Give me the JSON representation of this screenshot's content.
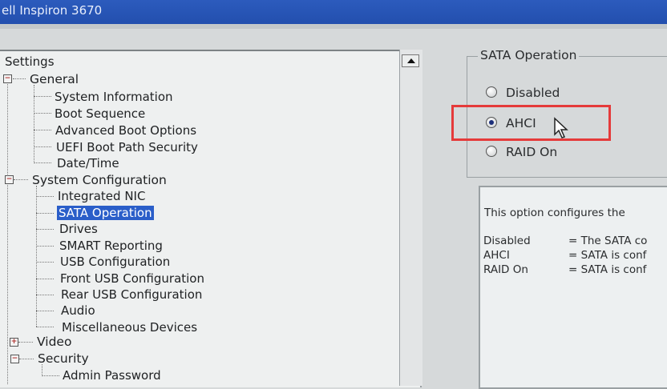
{
  "window": {
    "title": "ell Inspiron 3670"
  },
  "tree": {
    "header": "Settings",
    "general": {
      "label": "General",
      "items": [
        "System Information",
        "Boot Sequence",
        "Advanced Boot Options",
        "UEFI Boot Path Security",
        "Date/Time"
      ]
    },
    "system_configuration": {
      "label": "System Configuration",
      "items": [
        "Integrated NIC",
        "SATA Operation",
        "Drives",
        "SMART Reporting",
        "USB Configuration",
        "Front USB Configuration",
        "Rear USB Configuration",
        "Audio",
        "Miscellaneous Devices"
      ],
      "selected": "SATA Operation"
    },
    "video": {
      "label": "Video"
    },
    "security": {
      "label": "Security",
      "items": [
        "Admin Password"
      ]
    }
  },
  "sata_operation": {
    "title": "SATA Operation",
    "options": [
      "Disabled",
      "AHCI",
      "RAID On"
    ],
    "selected": "AHCI"
  },
  "description": {
    "intro": "This option configures the",
    "rows": [
      {
        "term": "Disabled",
        "text": "= The SATA co"
      },
      {
        "term": "AHCI",
        "text": "= SATA is conf"
      },
      {
        "term": "RAID On",
        "text": "= SATA is conf"
      }
    ]
  },
  "colors": {
    "selection": "#2a5ec9",
    "highlight_box": "#e53a3a",
    "titlebar": "#2c5bbd"
  }
}
